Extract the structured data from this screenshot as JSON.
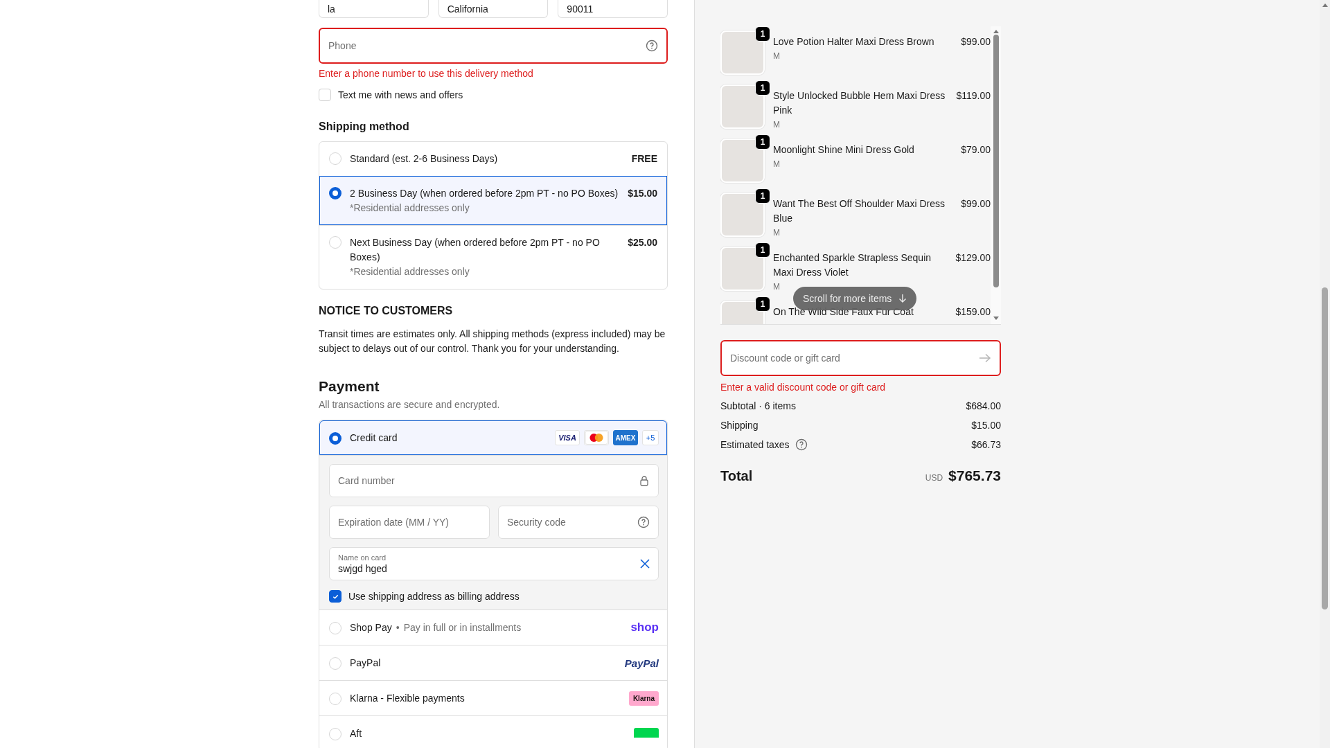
{
  "address_fields": [
    {
      "value": "la"
    },
    {
      "value": "California"
    },
    {
      "value": "90011"
    }
  ],
  "phone": {
    "placeholder": "Phone",
    "error": "Enter a phone number to use this delivery method"
  },
  "sms_optin": {
    "label": "Text me with news and offers",
    "checked": false
  },
  "shipping": {
    "heading": "Shipping method",
    "options": [
      {
        "label": "Standard (est. 2-6 Business Days)",
        "price": "FREE",
        "selected": false
      },
      {
        "label": "2 Business Day (when ordered before 2pm PT - no PO Boxes)",
        "note": "*Residential addresses only",
        "price": "$15.00",
        "selected": true
      },
      {
        "label": "Next Business Day (when ordered before 2pm PT - no PO Boxes)",
        "note": "*Residential addresses only",
        "price": "$25.00",
        "selected": false
      }
    ]
  },
  "notice": {
    "heading": "NOTICE TO CUSTOMERS",
    "text": "Transit times are estimates only. All shipping methods (express included) may be subject to delays out of our control. Thank you for your understanding."
  },
  "payment": {
    "heading": "Payment",
    "subtitle": "All transactions are secure and encrypted.",
    "methods": [
      {
        "kind": "card",
        "label": "Credit card",
        "selected": true
      },
      {
        "kind": "shop",
        "label": "Shop Pay",
        "separator": "•",
        "note": "Pay in full or in installments",
        "logo": "shop",
        "selected": false
      },
      {
        "kind": "paypal",
        "label": "PayPal",
        "logo": "PayPal",
        "selected": false
      },
      {
        "kind": "klarna",
        "label": "Klarna - Flexible payments",
        "logo": "Klarna",
        "selected": false
      },
      {
        "kind": "afterpay",
        "label": "Aft",
        "selected": false
      }
    ],
    "card_brands": [
      {
        "kind": "visa",
        "text": "VISA"
      },
      {
        "kind": "mastercard"
      },
      {
        "kind": "amex",
        "text": "AMEX"
      }
    ],
    "more_cards": "+5",
    "card_form": {
      "number_placeholder": "Card number",
      "expiry_placeholder": "Expiration date (MM / YY)",
      "cvv_placeholder": "Security code",
      "name_label": "Name on card",
      "name_value": "swjgd hged",
      "billing_same": {
        "label": "Use shipping address as billing address",
        "checked": true
      }
    }
  },
  "cart": {
    "items": [
      {
        "name": "Love Potion Halter Maxi Dress Brown",
        "variant": "M",
        "price": "$99.00",
        "quantity": "1"
      },
      {
        "name": "Style Unlocked Bubble Hem Maxi Dress Pink",
        "variant": "M",
        "price": "$119.00",
        "quantity": "1"
      },
      {
        "name": "Moonlight Shine Mini Dress Gold",
        "variant": "M",
        "price": "$79.00",
        "quantity": "1"
      },
      {
        "name": "Want The Best Off Shoulder Maxi Dress Blue",
        "variant": "M",
        "price": "$99.00",
        "quantity": "1"
      },
      {
        "name": "Enchanted Sparkle Strapless Sequin Maxi Dress Violet",
        "variant": "M",
        "price": "$129.00",
        "quantity": "1"
      },
      {
        "name": "On The Wild Side Faux Fur Coat",
        "price": "$159.00",
        "quantity": "1"
      }
    ],
    "scroll_hint": "Scroll for more items"
  },
  "discount": {
    "placeholder": "Discount code or gift card",
    "error": "Enter a valid discount code or gift card"
  },
  "summary": [
    {
      "label": "Subtotal · 6 items",
      "value": "$684.00",
      "help": false
    },
    {
      "label": "Shipping",
      "value": "$15.00",
      "help": false
    },
    {
      "label": "Estimated taxes",
      "value": "$66.73",
      "help": true
    }
  ],
  "total": {
    "label": "Total",
    "currency": "USD",
    "value": "$765.73"
  }
}
